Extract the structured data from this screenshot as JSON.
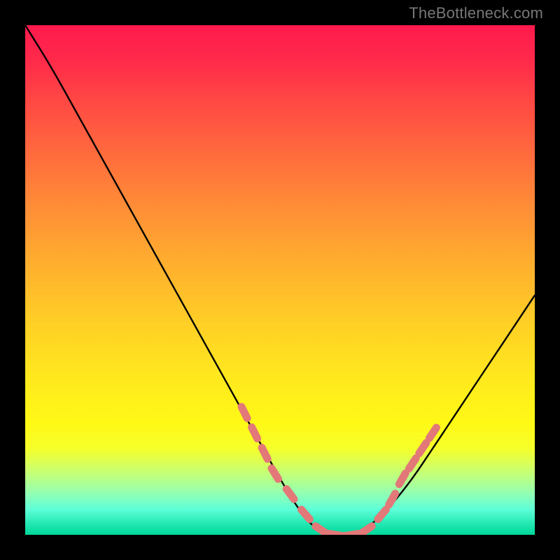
{
  "watermark": "TheBottleneck.com",
  "chart_data": {
    "type": "line",
    "title": "",
    "xlabel": "",
    "ylabel": "",
    "xlim": [
      0,
      100
    ],
    "ylim": [
      0,
      100
    ],
    "grid": false,
    "series": [
      {
        "name": "bottleneck-curve",
        "color": "#000000",
        "x": [
          0,
          5,
          10,
          15,
          20,
          25,
          30,
          35,
          40,
          45,
          50,
          53,
          56,
          59,
          62,
          65,
          68,
          72,
          76,
          80,
          84,
          88,
          92,
          96,
          100
        ],
        "values": [
          100,
          92,
          83,
          74,
          65,
          56,
          47,
          38,
          29,
          20,
          11,
          6,
          2,
          0,
          0,
          0,
          2,
          6,
          11,
          17,
          23,
          29,
          35,
          41,
          47
        ]
      }
    ],
    "markers": {
      "name": "measured-points",
      "color": "#e27878",
      "shape": "rounded-segment",
      "x": [
        43,
        45,
        47,
        49,
        52,
        55,
        58,
        61,
        64,
        67,
        70,
        72,
        74,
        76,
        78,
        80
      ],
      "values": [
        24,
        20,
        16,
        12,
        8,
        4,
        1,
        0,
        0,
        1,
        4,
        7,
        11,
        14,
        17,
        20
      ]
    },
    "background_gradient": {
      "type": "vertical",
      "stops": [
        {
          "pos": 0.0,
          "color": "#ff1a4d"
        },
        {
          "pos": 0.25,
          "color": "#ff6a3d"
        },
        {
          "pos": 0.5,
          "color": "#ffce26"
        },
        {
          "pos": 0.78,
          "color": "#fff916"
        },
        {
          "pos": 0.9,
          "color": "#90ffb4"
        },
        {
          "pos": 1.0,
          "color": "#00d89a"
        }
      ]
    }
  }
}
